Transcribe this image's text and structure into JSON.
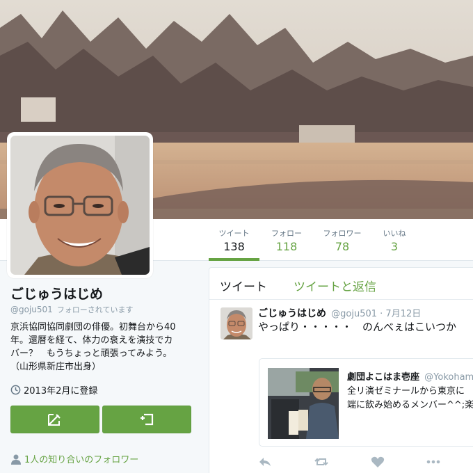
{
  "stats": {
    "tweets": {
      "label": "ツイート",
      "value": "138"
    },
    "following": {
      "label": "フォロー",
      "value": "118"
    },
    "followers": {
      "label": "フォロワー",
      "value": "78"
    },
    "likes": {
      "label": "いいね",
      "value": "3"
    }
  },
  "profile": {
    "name": "ごじゅうはじめ",
    "handle": "@goju501",
    "follows_you": "フォローされています",
    "bio_lines": [
      "京浜協同協同劇団の俳優。初舞台から40",
      "年。還暦を経て、体力の衰えを演技でカ",
      "バー？　もうちょっと頑張ってみよう。",
      "（山形県新庄市出身）"
    ],
    "joined": "2013年2月に登録",
    "known_followers": "1人の知り合いのフォロワー"
  },
  "timeline": {
    "tabs": {
      "tweets": "ツイート",
      "tweets_replies": "ツイートと返信"
    },
    "tweet": {
      "name": "ごじゅうはじめ",
      "handle": "@goju501",
      "date": "· 7月12日",
      "text": "やっぱり・・・・・　のんべぇはこいつか"
    },
    "quote": {
      "name": "劇団よこはま壱座",
      "handle": "@Yokoham",
      "lines": [
        "全リ演ゼミナールから東京に",
        "端に飲み始めるメンバー^^;楽"
      ]
    }
  },
  "colors": {
    "accent": "#66a343",
    "text": "#14171a",
    "muted": "#8899a6"
  },
  "icons": [
    "clock-icon",
    "compose-icon",
    "retweet-box-icon",
    "person-icon",
    "reply-icon",
    "retweet-icon",
    "heart-icon",
    "more-icon"
  ]
}
